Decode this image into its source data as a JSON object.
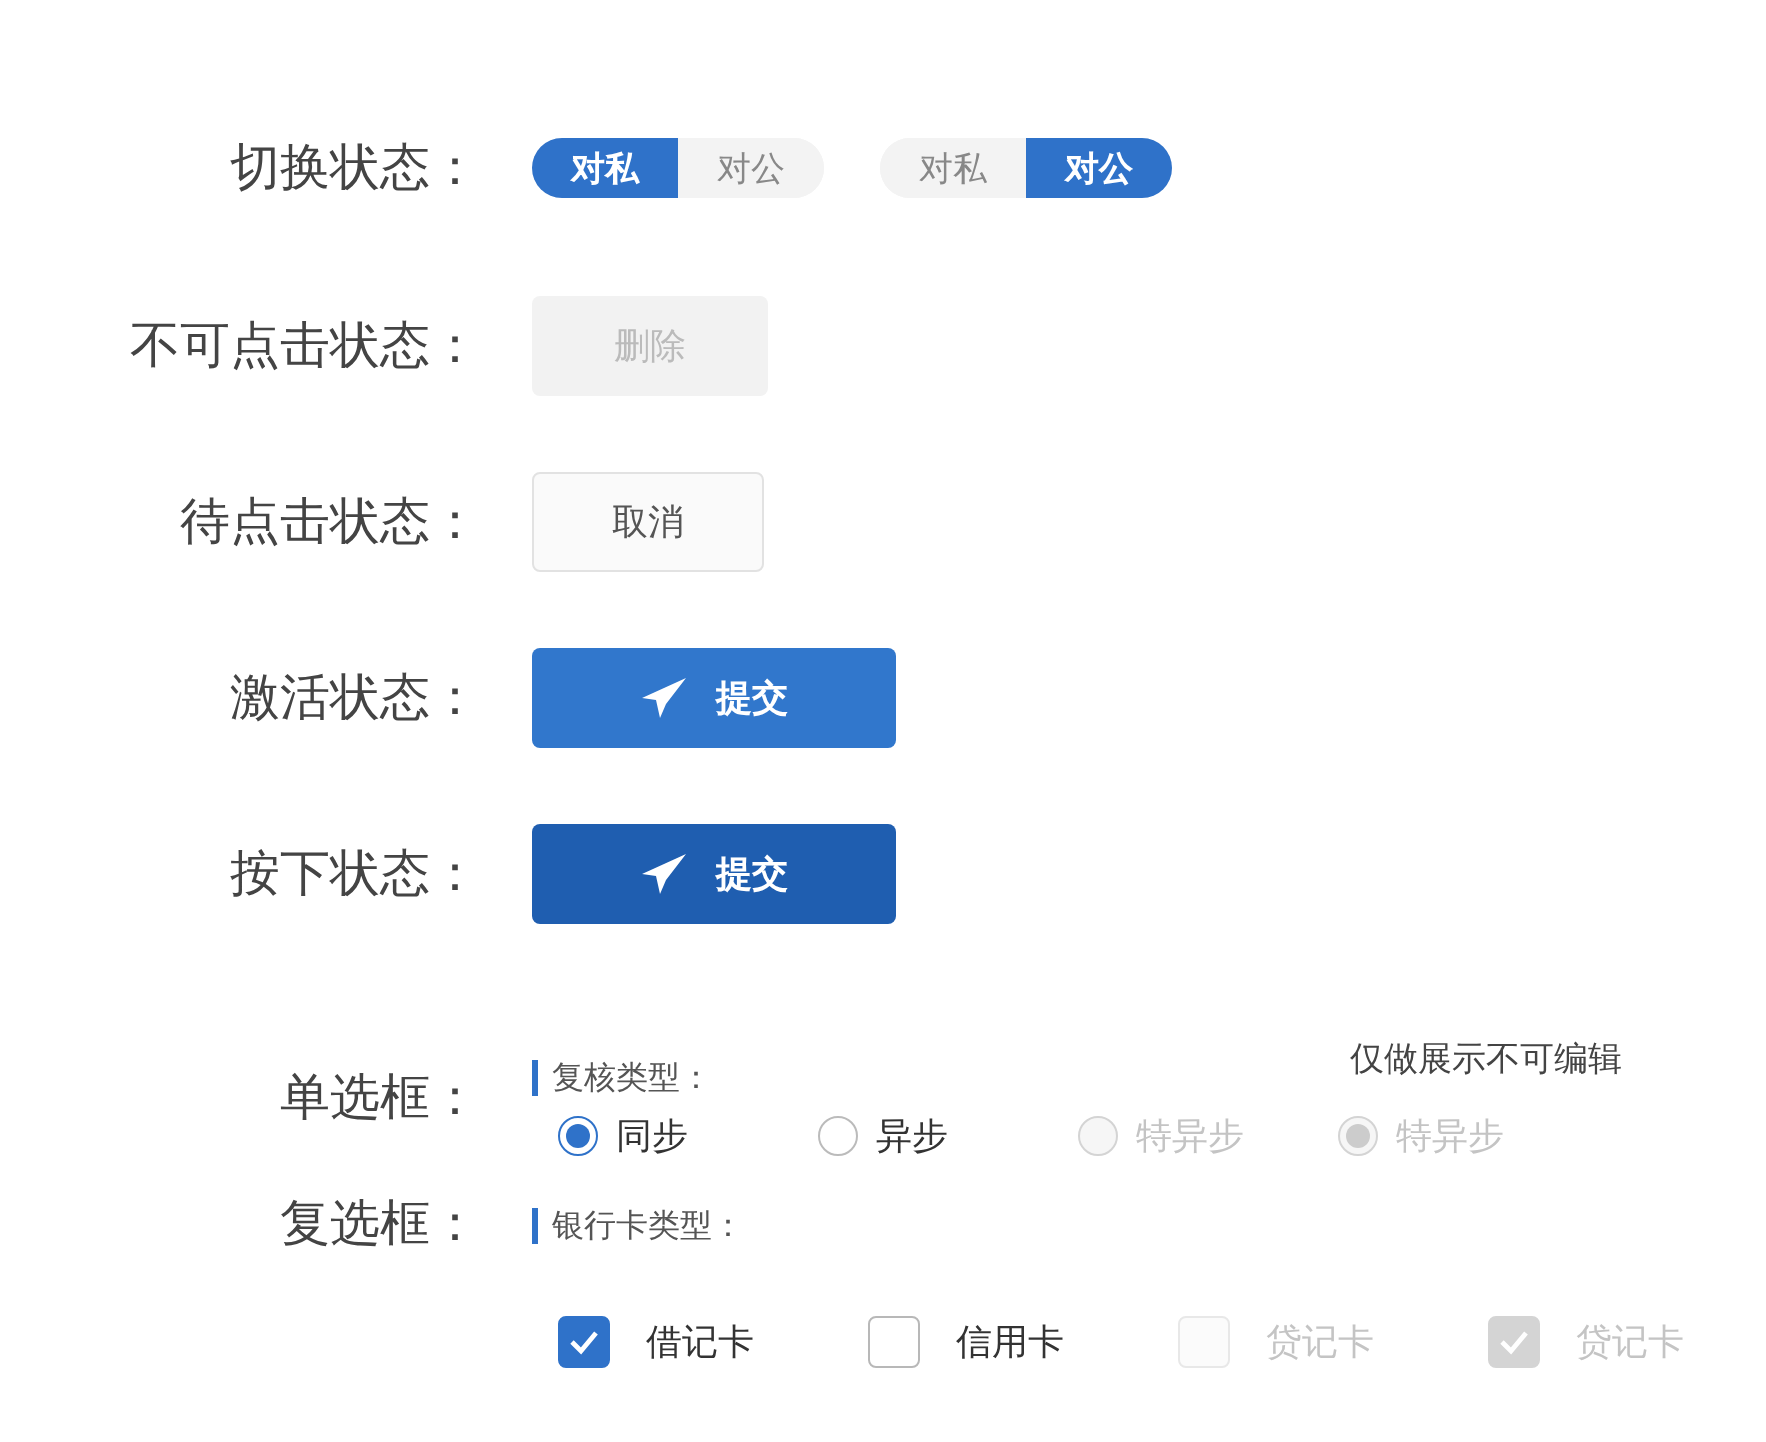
{
  "rows": [
    {
      "kind": "toggle",
      "label": "切换状态：",
      "toggles": [
        {
          "options": [
            {
              "label": "对私",
              "selected": true
            },
            {
              "label": "对公",
              "selected": false
            }
          ]
        },
        {
          "options": [
            {
              "label": "对私",
              "selected": false
            },
            {
              "label": "对公",
              "selected": true
            }
          ]
        }
      ]
    },
    {
      "kind": "button",
      "label": "不可点击状态：",
      "button": {
        "text": "删除",
        "kind": "default",
        "disabled": true
      }
    },
    {
      "kind": "button",
      "label": "待点击状态：",
      "button": {
        "text": "取消",
        "kind": "default",
        "disabled": false,
        "pressed": false
      }
    },
    {
      "kind": "button",
      "label": "激活状态：",
      "button": {
        "text": "提交",
        "kind": "primary",
        "disabled": false,
        "pressed": false
      }
    },
    {
      "kind": "button",
      "label": "按下状态：",
      "button": {
        "text": "提交",
        "kind": "primary",
        "disabled": false,
        "pressed": true
      }
    },
    {
      "kind": "radio",
      "label": "单选框：",
      "group_title": "复核类型：",
      "note": "仅做展示不可编辑",
      "options": [
        {
          "label": "同步",
          "selected": true,
          "disabled": false
        },
        {
          "label": "异步",
          "selected": false,
          "disabled": false
        },
        {
          "label": "特异步",
          "selected": false,
          "disabled": true
        },
        {
          "label": "特异步",
          "selected": true,
          "disabled": true
        }
      ]
    },
    {
      "kind": "checkbox",
      "label": "复选框：",
      "group_title": "银行卡类型：",
      "options": [
        {
          "label": "借记卡",
          "checked": true,
          "disabled": false
        },
        {
          "label": "信用卡",
          "checked": false,
          "disabled": false
        },
        {
          "label": "贷记卡",
          "checked": false,
          "disabled": true
        },
        {
          "label": "贷记卡",
          "checked": true,
          "disabled": true
        }
      ]
    }
  ]
}
